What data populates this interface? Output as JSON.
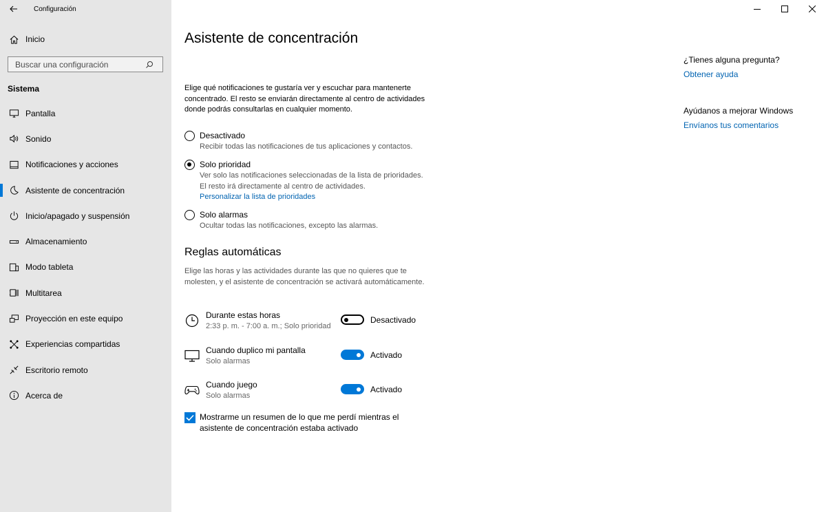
{
  "app": {
    "title": "Configuración"
  },
  "sidebar": {
    "home_label": "Inicio",
    "search_placeholder": "Buscar una configuración",
    "section_title": "Sistema",
    "items": [
      {
        "label": "Pantalla",
        "icon": "display-icon"
      },
      {
        "label": "Sonido",
        "icon": "speaker-icon"
      },
      {
        "label": "Notificaciones y acciones",
        "icon": "notifications-icon"
      },
      {
        "label": "Asistente de concentración",
        "icon": "moon-icon",
        "active": true
      },
      {
        "label": "Inicio/apagado y suspensión",
        "icon": "power-icon"
      },
      {
        "label": "Almacenamiento",
        "icon": "storage-icon"
      },
      {
        "label": "Modo tableta",
        "icon": "tablet-icon"
      },
      {
        "label": "Multitarea",
        "icon": "multitask-icon"
      },
      {
        "label": "Proyección en este equipo",
        "icon": "projection-icon"
      },
      {
        "label": "Experiencias compartidas",
        "icon": "shared-icon"
      },
      {
        "label": "Escritorio remoto",
        "icon": "remote-icon"
      },
      {
        "label": "Acerca de",
        "icon": "info-icon"
      }
    ]
  },
  "main": {
    "title": "Asistente de concentración",
    "description": "Elige qué notificaciones te gustaría ver y escuchar para mantenerte concentrado. El resto se enviarán directamente al centro de actividades donde podrás consultarlas en cualquier momento.",
    "options": [
      {
        "label": "Desactivado",
        "sub": "Recibir todas las notificaciones de tus aplicaciones y contactos.",
        "checked": false
      },
      {
        "label": "Solo prioridad",
        "sub": "Ver solo las notificaciones seleccionadas de la lista de prioridades. El resto irá directamente al centro de actividades.",
        "link": "Personalizar la lista de prioridades",
        "checked": true
      },
      {
        "label": "Solo alarmas",
        "sub": "Ocultar todas las notificaciones, excepto las alarmas.",
        "checked": false
      }
    ],
    "rules_title": "Reglas automáticas",
    "rules_description": "Elige las horas y las actividades durante las que no quieres que te molesten, y el asistente de concentración se activará automáticamente.",
    "rules": [
      {
        "label": "Durante estas horas",
        "sub": "2:33 p. m. - 7:00 a. m.; Solo prioridad",
        "state": "Desactivado",
        "on": false,
        "icon": "clock-icon"
      },
      {
        "label": "Cuando duplico mi pantalla",
        "sub": "Solo alarmas",
        "state": "Activado",
        "on": true,
        "icon": "monitor-icon"
      },
      {
        "label": "Cuando juego",
        "sub": "Solo alarmas",
        "state": "Activado",
        "on": true,
        "icon": "gamepad-icon"
      }
    ],
    "summary_checkbox": "Mostrarme un resumen de lo que me perdí mientras el asistente de concentración estaba activado"
  },
  "help": {
    "question": "¿Tienes alguna pregunta?",
    "help_link": "Obtener ayuda",
    "improve": "Ayúdanos a mejorar Windows",
    "feedback_link": "Envíanos tus comentarios"
  },
  "colors": {
    "accent": "#0078d7",
    "link": "#0063b1",
    "sidebar_bg": "#e6e6e6"
  }
}
